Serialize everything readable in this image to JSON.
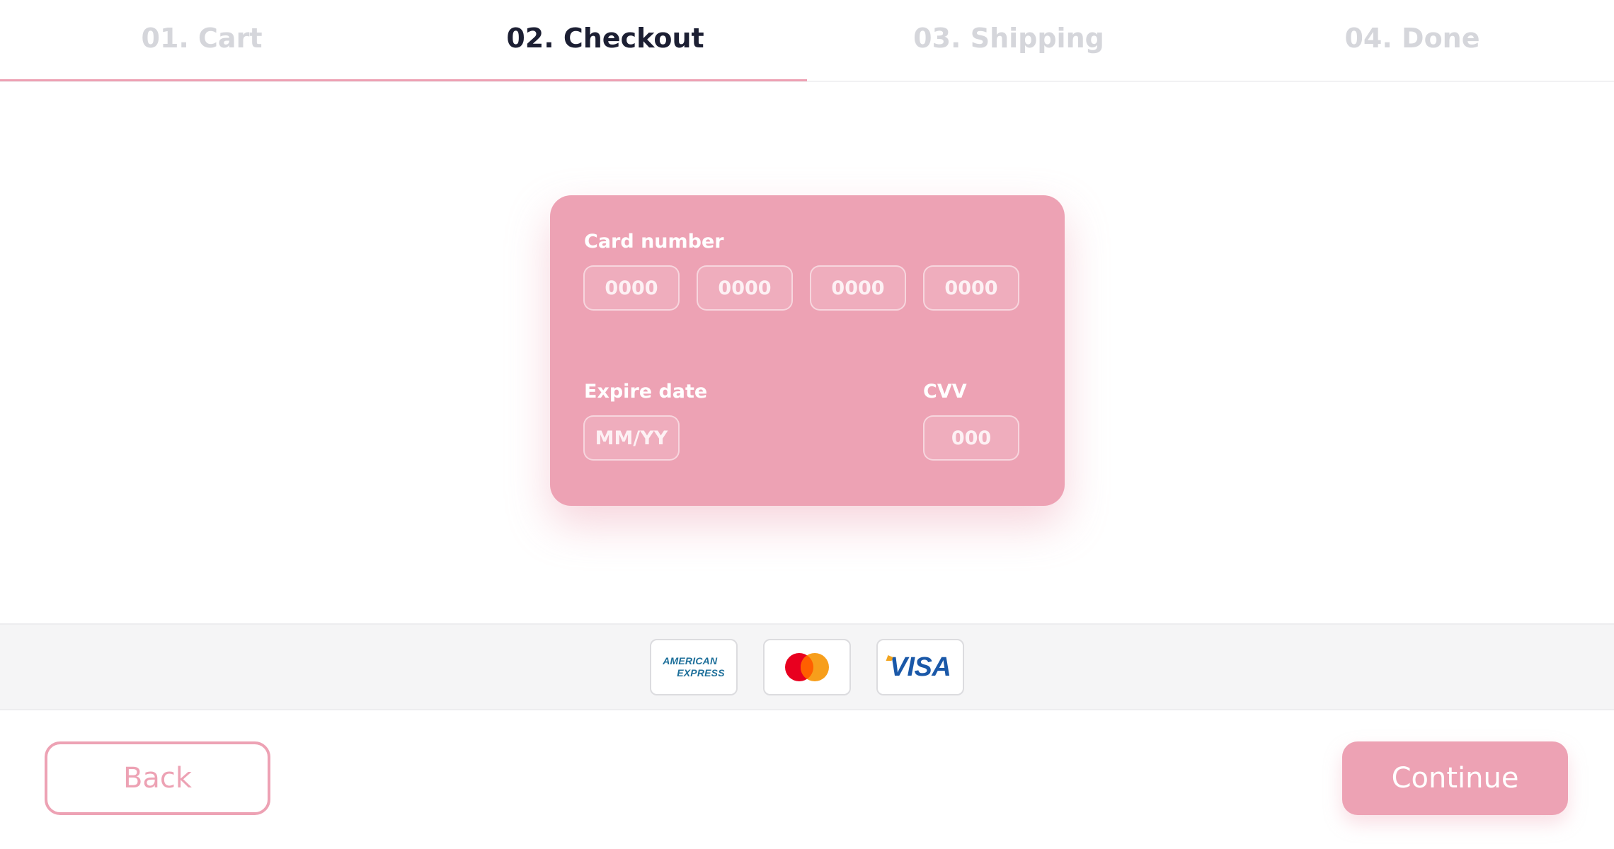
{
  "steps": [
    {
      "label": "01. Cart",
      "active": false
    },
    {
      "label": "02. Checkout",
      "active": true
    },
    {
      "label": "03. Shipping",
      "active": false
    },
    {
      "label": "04. Done",
      "active": false
    }
  ],
  "card": {
    "number_label": "Card number",
    "number_placeholders": [
      "0000",
      "0000",
      "0000",
      "0000"
    ],
    "number_values": [
      "",
      "",
      "",
      ""
    ],
    "expire_label": "Expire date",
    "expire_placeholder": "MM/YY",
    "expire_value": "",
    "cvv_label": "CVV",
    "cvv_placeholder": "000",
    "cvv_value": ""
  },
  "payment_methods": {
    "amex_line1": "AMERICAN",
    "amex_line2": "EXPRESS",
    "mastercard": "mastercard-logo",
    "visa": "VISA"
  },
  "buttons": {
    "back": "Back",
    "continue": "Continue"
  },
  "colors": {
    "accent": "#eda2b4",
    "active_step": "#1c1f33",
    "inactive_step": "#d5d6db"
  }
}
